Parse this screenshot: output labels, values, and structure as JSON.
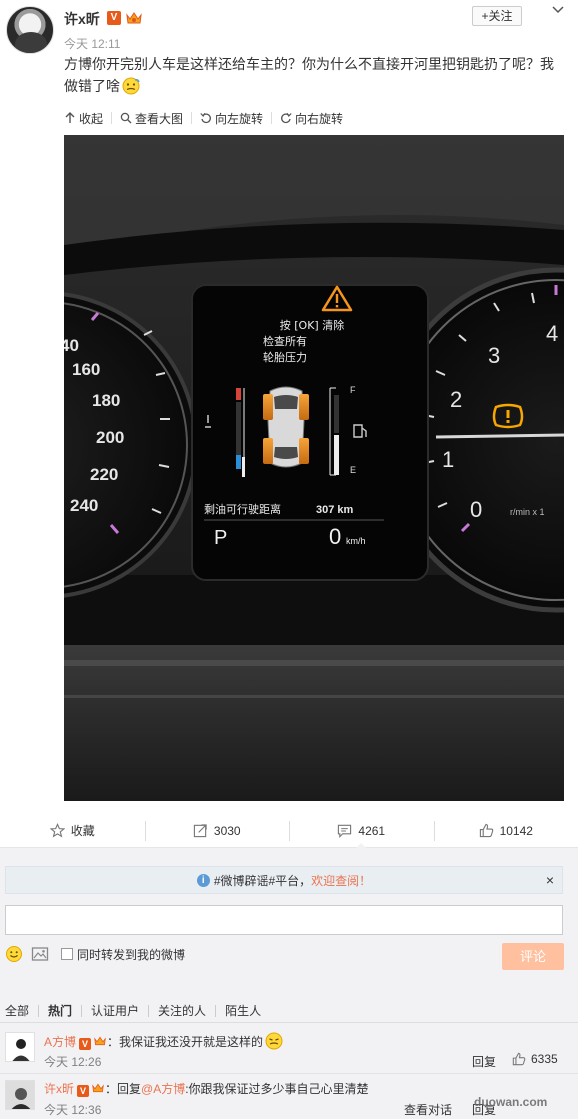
{
  "post": {
    "username": "许x昕",
    "verified_badge": "V",
    "follow_label": "+关注",
    "time": "今天 12:11",
    "text": "方博你开完别人车是这样还给车主的？你为什么不直接开河里把钥匙扔了呢？我做错了啥",
    "toolbar": {
      "collapse": "收起",
      "view_large": "查看大图",
      "rotate_left": "向左旋转",
      "rotate_right": "向右旋转"
    },
    "dashboard": {
      "warning_line1": "按 [OK] 清除",
      "warning_line2": "检查所有",
      "warning_line3": "轮胎压力",
      "range_label": "剩油可行驶距离",
      "range_value": "307 km",
      "gear": "P",
      "speed": "0",
      "speed_unit": "km/h",
      "fuel_full": "F",
      "fuel_empty": "E",
      "rpm_unit": "r/min x 1",
      "speed_ticks": [
        "40",
        "160",
        "180",
        "200",
        "220",
        "240"
      ],
      "rpm_ticks": [
        "4",
        "3",
        "2",
        "1",
        "0"
      ]
    }
  },
  "actions": {
    "favorite": "收藏",
    "reposts": "3030",
    "comments": "4261",
    "likes": "10142"
  },
  "comment_box": {
    "notice_text": "#微博辟谣#平台，",
    "notice_link": "欢迎查阅！",
    "close": "×",
    "repost_check_label": "同时转发到我的微博",
    "submit_label": "评论"
  },
  "tabs": [
    "全部",
    "热门",
    "认证用户",
    "关注的人",
    "陌生人"
  ],
  "comments": [
    {
      "name": "A方博",
      "badge": "V",
      "text": "：我保证我还没开就是这样的",
      "time": "今天 12:26",
      "reply": "回复",
      "likes": "6335"
    },
    {
      "name": "许x昕",
      "badge": "V",
      "text_prefix": "：回复",
      "mention": "@A方博",
      "text": ":你跟我保证过多少事自己心里清楚",
      "time": "今天 12:36",
      "view_thread": "查看对话",
      "reply": "回复"
    }
  ],
  "watermark": "duowan.com",
  "colors": {
    "accent": "#eb7350",
    "vip": "#e75a1a",
    "submit_disabled": "#ffc09f",
    "dash_amber": "#f7941d"
  }
}
